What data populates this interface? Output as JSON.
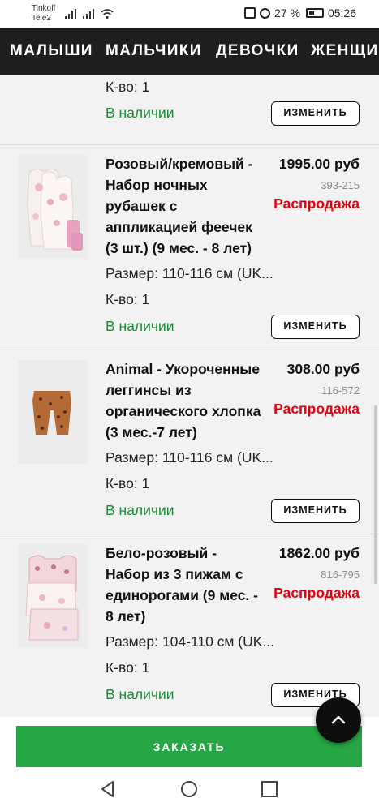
{
  "status_bar": {
    "carrier_1": "Tinkoff",
    "carrier_2": "Tele2",
    "battery": "27 %",
    "time": "05:26"
  },
  "nav": {
    "tabs": [
      "МАЛЫШИ",
      "МАЛЬЧИКИ",
      "ДЕВОЧКИ",
      "ЖЕНЩИ"
    ]
  },
  "cart": {
    "change_label": "ИЗМЕНИТЬ",
    "partial_item": {
      "qty": "К-во: 1",
      "availability": "В наличии"
    },
    "items": [
      {
        "title": "Розовый/кремовый - Набор ночных рубашек с аппликацией феечек (3 шт.) (9 мес. - 8 лет)",
        "price": "1995.00 руб",
        "code": "393-215",
        "sale": "Распродажа",
        "size": "Размер: 110-116 см (UK...",
        "qty": "К-во: 1",
        "availability": "В наличии",
        "image": "pink-nightdress-set"
      },
      {
        "title": "Animal - Укороченные леггинсы из органического хлопка (3 мес.-7 лет)",
        "price": "308.00 руб",
        "code": "116-572",
        "sale": "Распродажа",
        "size": "Размер: 110-116 см (UK...",
        "qty": "К-во: 1",
        "availability": "В наличии",
        "image": "leopard-leggings"
      },
      {
        "title": "Бело-розовый - Набор из 3 пижам с единорогами (9 мес. - 8 лет)",
        "price": "1862.00 руб",
        "code": "816-795",
        "sale": "Распродажа",
        "size": "Размер: 104-110 см (UK...",
        "qty": "К-во: 1",
        "availability": "В наличии",
        "image": "unicorn-pyjamas-set"
      }
    ]
  },
  "order_button": "ЗАКАЗАТЬ",
  "colors": {
    "nav_bg": "#1e1e1e",
    "available_green": "#1c8b36",
    "sale_red": "#e3000f",
    "order_green": "#27a645"
  }
}
